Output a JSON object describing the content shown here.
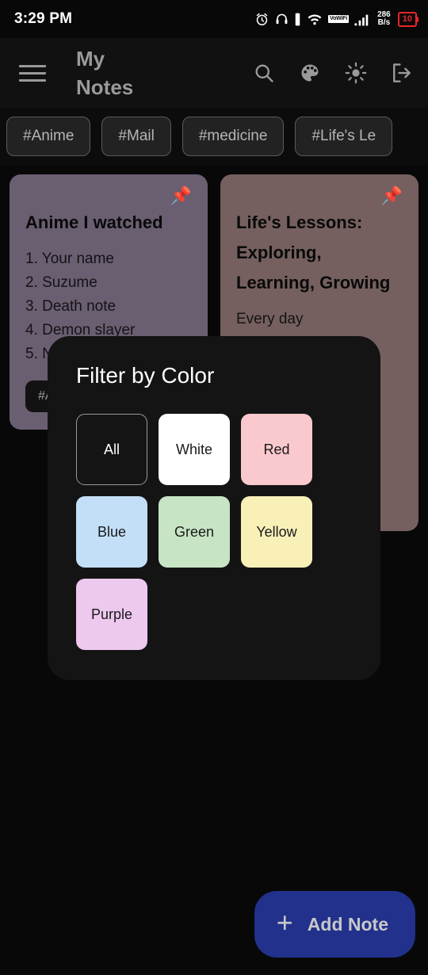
{
  "status_bar": {
    "time": "3:29 PM",
    "icons": [
      "alarm-icon",
      "headphones-icon",
      "vibrate-icon",
      "wifi-icon"
    ],
    "vowifi_label": "VoWiFi",
    "net_speed_value": "286",
    "net_speed_unit": "B/s",
    "battery_level": "10"
  },
  "app_bar": {
    "menu_icon": "hamburger-menu-icon",
    "title": "My Notes",
    "actions": [
      {
        "name": "search-icon",
        "label": "Search"
      },
      {
        "name": "palette-icon",
        "label": "Theme color"
      },
      {
        "name": "brightness-icon",
        "label": "Brightness"
      },
      {
        "name": "logout-icon",
        "label": "Logout"
      }
    ]
  },
  "tags": [
    {
      "label": "#Anime"
    },
    {
      "label": "#Mail"
    },
    {
      "label": "#medicine"
    },
    {
      "label": "#Life's Le"
    }
  ],
  "notes": [
    {
      "title": "Anime I watched",
      "body": "1. Your name\n2. Suzume\n3. Death note\n4. Demon slayer\n5. Naruto",
      "tag": "#Anime",
      "color": "#6a5e71",
      "pinned": true,
      "pin_icon": "pin-icon"
    },
    {
      "title": "Life's Lessons: Exploring, Learning, Growing",
      "body": "Every day\n\nexp...",
      "color": "#75605f",
      "pinned": true,
      "pin_icon": "pin-icon"
    }
  ],
  "dialog": {
    "title": "Filter by Color",
    "swatches": [
      {
        "label": "All",
        "bg": "#141414",
        "fg": "#ffffff",
        "border": "#9a9a9a"
      },
      {
        "label": "White",
        "bg": "#ffffff",
        "fg": "#1a1a1a",
        "border": "transparent"
      },
      {
        "label": "Red",
        "bg": "#fac9cd",
        "fg": "#1a1a1a",
        "border": "transparent"
      },
      {
        "label": "Blue",
        "bg": "#c2dff7",
        "fg": "#1a1a1a",
        "border": "transparent"
      },
      {
        "label": "Green",
        "bg": "#c7e5c5",
        "fg": "#1a1a1a",
        "border": "transparent"
      },
      {
        "label": "Yellow",
        "bg": "#f8f0b7",
        "fg": "#1a1a1a",
        "border": "transparent"
      },
      {
        "label": "Purple",
        "bg": "#edc8ef",
        "fg": "#1a1a1a",
        "border": "transparent"
      }
    ]
  },
  "fab": {
    "plus_icon": "plus-icon",
    "label": "Add Note"
  }
}
